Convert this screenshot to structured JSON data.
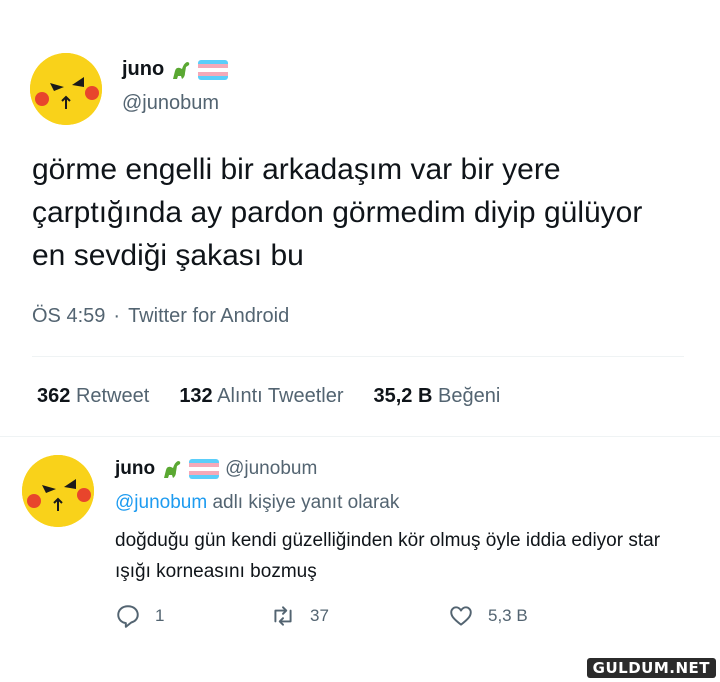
{
  "main_tweet": {
    "author_name": "juno",
    "author_handle": "@junobum",
    "text": "görme engelli bir arkadaşım var bir yere çarptığında ay pardon görmedim diyip gülüyor en sevdiği şakası bu",
    "time": "ÖS 4:59",
    "separator": "·",
    "source": "Twitter for Android",
    "stats": [
      {
        "count": "362",
        "label": "Retweet"
      },
      {
        "count": "132",
        "label": "Alıntı Tweetler"
      },
      {
        "count": "35,2 B",
        "label": "Beğeni"
      }
    ]
  },
  "reply_tweet": {
    "author_name": "juno",
    "author_handle": "@junobum",
    "replying_mention": "@junobum",
    "replying_suffix": "adlı kişiye yanıt olarak",
    "text": "doğduğu gün kendi güzelliğinden kör olmuş öyle iddia ediyor star ışığı korneasını bozmuş",
    "actions": {
      "reply_count": "1",
      "retweet_count": "37",
      "like_count": "5,3 B"
    }
  },
  "icons": {
    "name_emoji": "dinosaur-icon",
    "name_flag": "trans-flag-icon",
    "reply_action": "comment-icon",
    "retweet_action": "retweet-icon",
    "like_action": "heart-icon"
  },
  "colors": {
    "text": "#0f1419",
    "secondary": "#536471",
    "link": "#1d9bf0",
    "avatar": "#f9d21a"
  },
  "watermark": "GULDUM.NET"
}
